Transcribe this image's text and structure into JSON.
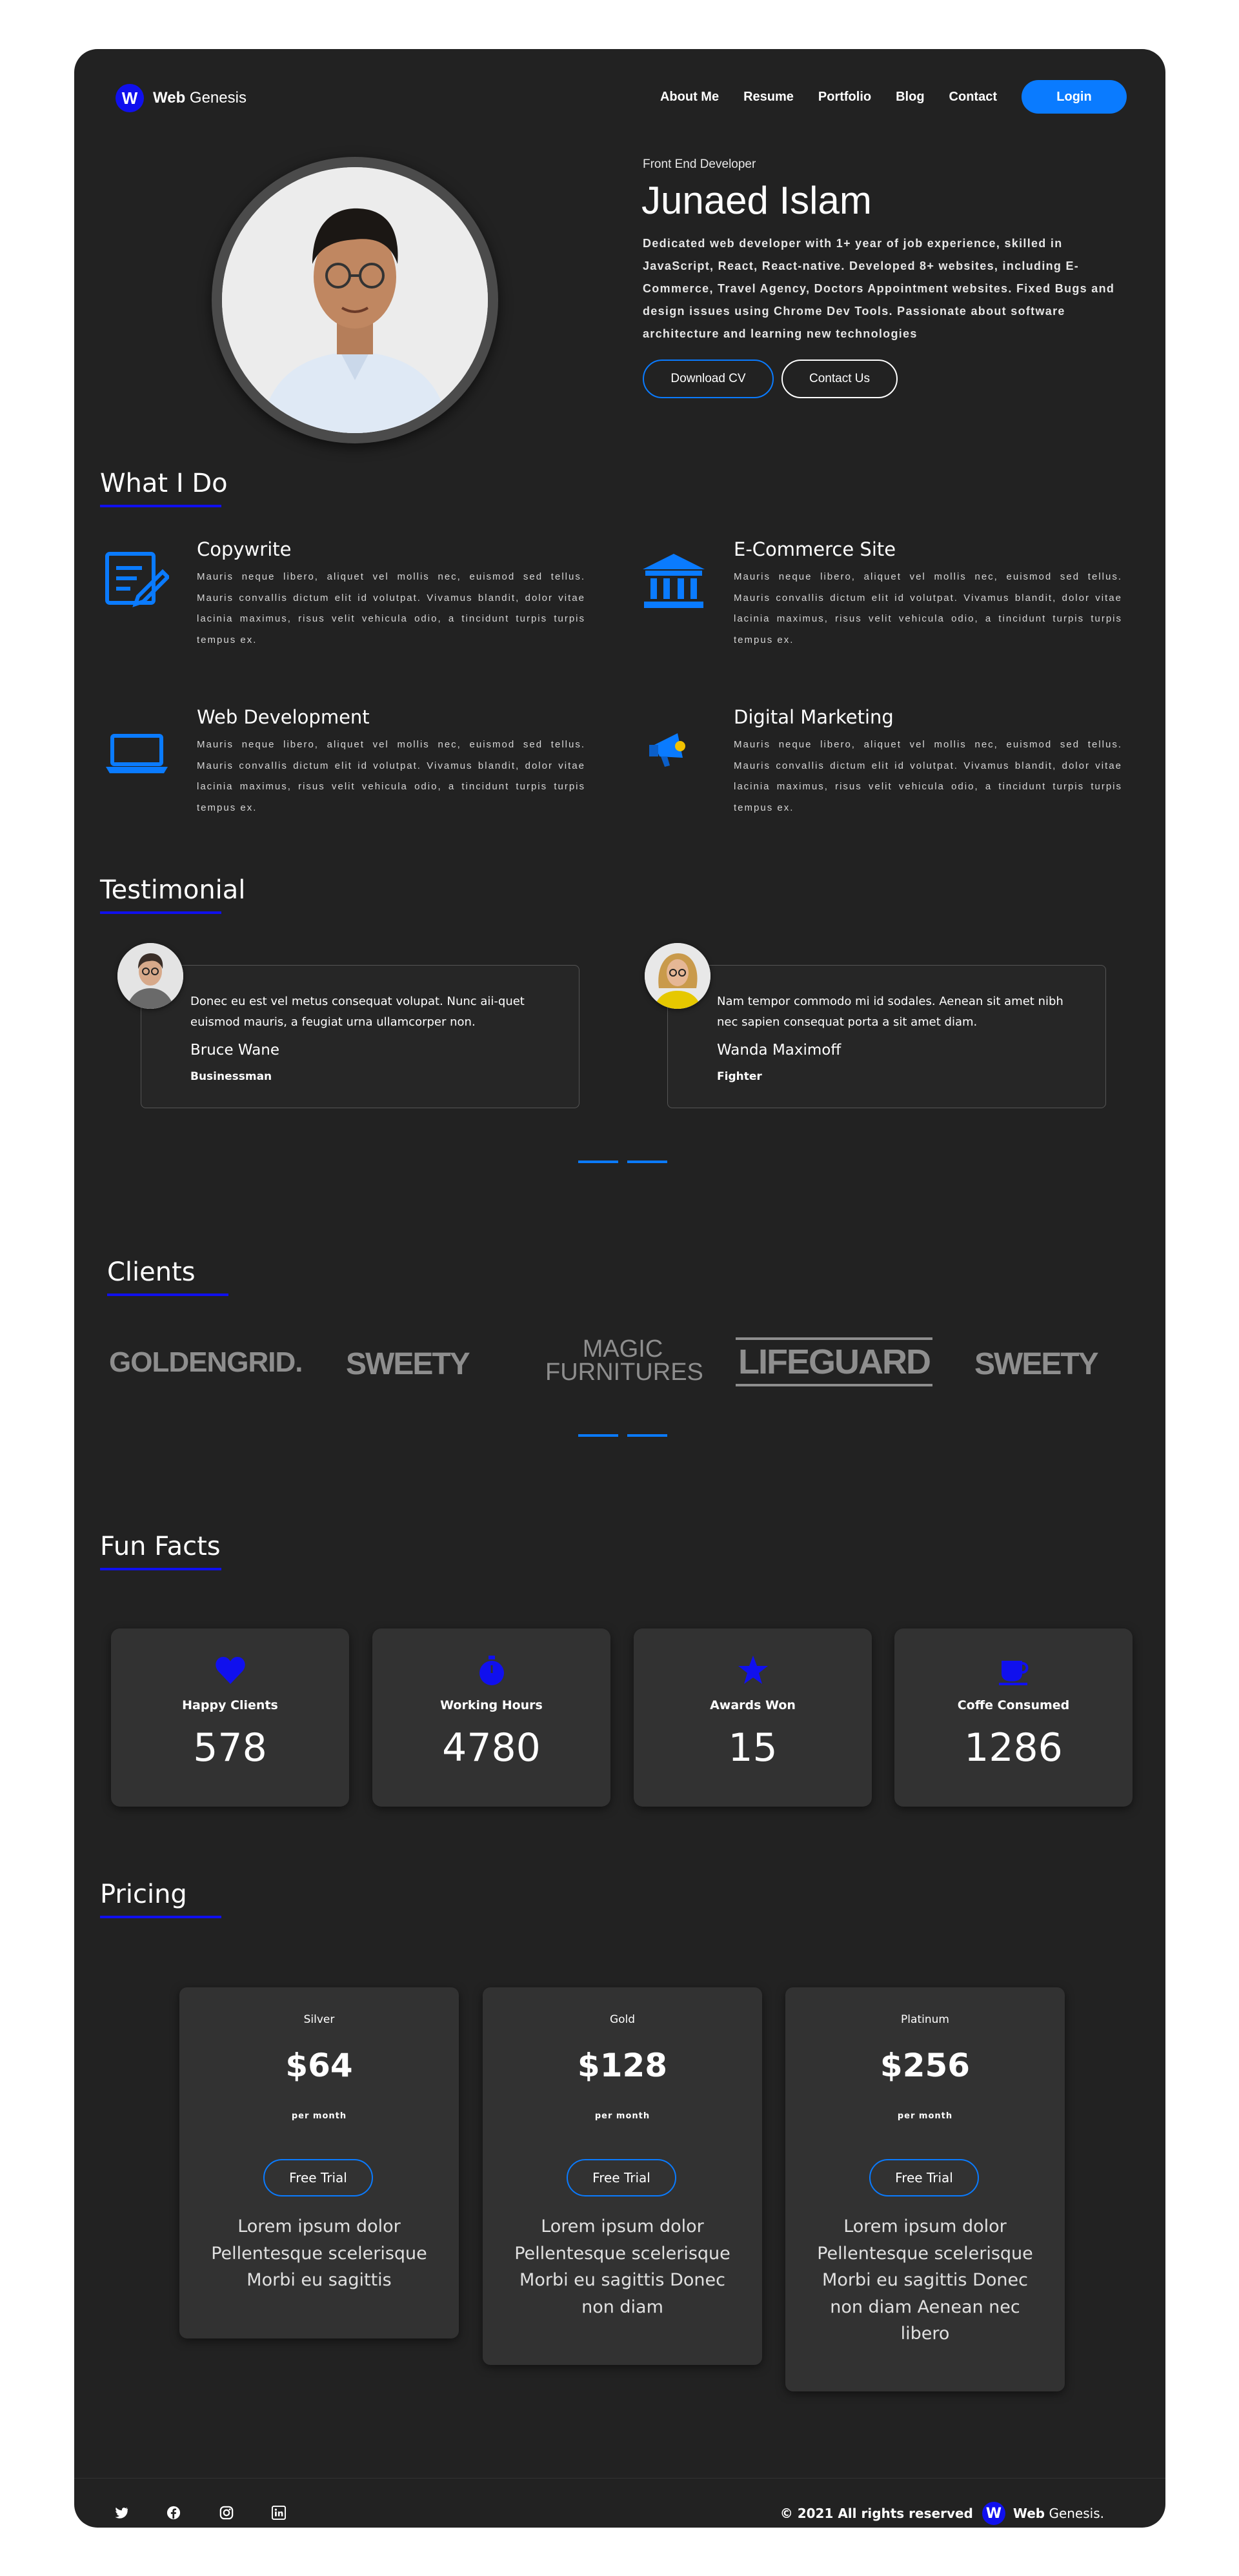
{
  "brand": {
    "badge": "W",
    "bold": "Web",
    "rest": "Genesis"
  },
  "nav": {
    "links": [
      "About Me",
      "Resume",
      "Portfolio",
      "Blog",
      "Contact"
    ],
    "login": "Login"
  },
  "hero": {
    "subtitle": "Front End Developer",
    "name": "Junaed Islam",
    "description": "Dedicated web developer with 1+ year of job experience, skilled in JavaScript, React, React-native. Developed 8+ websites, including E-Commerce, Travel Agency, Doctors Appointment websites. Fixed Bugs and design issues using Chrome Dev Tools. Passionate about software architecture and learning new technologies",
    "btn_cv": "Download CV",
    "btn_contact": "Contact Us"
  },
  "services": {
    "title": "What I Do",
    "items": [
      {
        "title": "Copywrite",
        "icon": "copywrite-icon",
        "text": "Mauris neque libero, aliquet vel mollis nec, euismod sed tellus. Mauris convallis dictum elit id volutpat. Vivamus blandit, dolor vitae lacinia maximus, risus velit vehicula odio, a tincidunt turpis turpis tempus ex."
      },
      {
        "title": "E-Commerce Site",
        "icon": "bank-icon",
        "text": "Mauris neque libero, aliquet vel mollis nec, euismod sed tellus. Mauris convallis dictum elit id volutpat. Vivamus blandit, dolor vitae lacinia maximus, risus velit vehicula odio, a tincidunt turpis turpis tempus ex."
      },
      {
        "title": "Web Development",
        "icon": "laptop-icon",
        "text": "Mauris neque libero, aliquet vel mollis nec, euismod sed tellus. Mauris convallis dictum elit id volutpat. Vivamus blandit, dolor vitae lacinia maximus, risus velit vehicula odio, a tincidunt turpis turpis tempus ex."
      },
      {
        "title": "Digital Marketing",
        "icon": "megaphone-icon",
        "text": "Mauris neque libero, aliquet vel mollis nec, euismod sed tellus. Mauris convallis dictum elit id volutpat. Vivamus blandit, dolor vitae lacinia maximus, risus velit vehicula odio, a tincidunt turpis turpis tempus ex."
      }
    ]
  },
  "testimonial": {
    "title": "Testimonial",
    "items": [
      {
        "quote": "Donec eu est vel metus consequat volupat. Nunc aii-quet euismod mauris, a feugiat urna ullamcorper non.",
        "name": "Bruce Wane",
        "role": "Businessman"
      },
      {
        "quote": "Nam tempor commodo mi id sodales. Aenean sit amet nibh nec sapien consequat porta a sit amet diam.",
        "name": "Wanda Maximoff",
        "role": "Fighter"
      }
    ]
  },
  "clients": {
    "title": "Clients",
    "logos": [
      "GOLDENGRID.",
      "SWEETY",
      "MAGIC",
      "FURNITURES",
      "LIFEGUARD",
      "SWEETY"
    ]
  },
  "facts": {
    "title": "Fun Facts",
    "items": [
      {
        "label": "Happy Clients",
        "value": "578",
        "icon": "heart-icon"
      },
      {
        "label": "Working Hours",
        "value": "4780",
        "icon": "stopwatch-icon"
      },
      {
        "label": "Awards Won",
        "value": "15",
        "icon": "star-icon"
      },
      {
        "label": "Coffe Consumed",
        "value": "1286",
        "icon": "coffee-cup-icon"
      }
    ]
  },
  "pricing": {
    "title": "Pricing",
    "plans": [
      {
        "tier": "Silver",
        "price": "$64",
        "per": "per month",
        "cta": "Free Trial",
        "features": "Lorem ipsum dolor Pellentesque scelerisque Morbi eu sagittis"
      },
      {
        "tier": "Gold",
        "price": "$128",
        "per": "per month",
        "cta": "Free Trial",
        "features": "Lorem ipsum dolor Pellentesque scelerisque Morbi eu sagittis Donec non diam"
      },
      {
        "tier": "Platinum",
        "price": "$256",
        "per": "per month",
        "cta": "Free Trial",
        "features": "Lorem ipsum dolor Pellentesque scelerisque Morbi eu sagittis Donec non diam Aenean nec libero"
      }
    ]
  },
  "footer": {
    "social": [
      "twitter-icon",
      "facebook-icon",
      "instagram-icon",
      "linkedin-icon"
    ],
    "copyright": "© 2021 All rights reserved",
    "brand_bold": "Web",
    "brand_rest": "Genesis."
  },
  "colors": {
    "accent": "#0a7bff",
    "brand": "#1010ee",
    "background": "#222222",
    "card": "#323232"
  }
}
